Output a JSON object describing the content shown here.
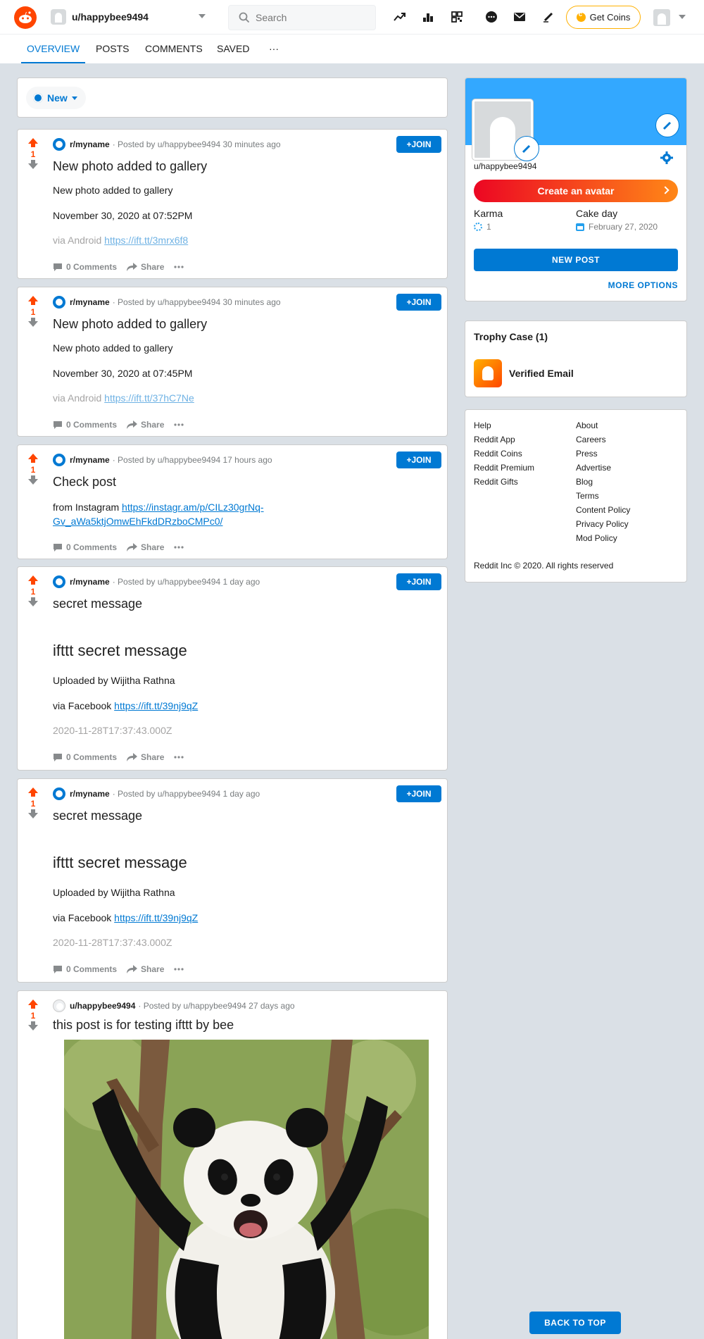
{
  "header": {
    "username": "u/happybee9494",
    "search_placeholder": "Search",
    "coins_label": "Get Coins"
  },
  "tabs": [
    "OVERVIEW",
    "POSTS",
    "COMMENTS",
    "SAVED",
    "···"
  ],
  "sort": {
    "label": "New"
  },
  "posts": [
    {
      "subreddit": "r/myname",
      "posted_by": "· Posted by u/happybee9494 30 minutes ago",
      "votes": "1",
      "join": "+JOIN",
      "title": "New photo added to gallery",
      "line1": "New photo added to gallery",
      "line2": "November 30, 2020 at 07:52PM",
      "via": "via Android ",
      "link": "https://ift.tt/3mrx6f8",
      "comments": "0 Comments",
      "share": "Share"
    },
    {
      "subreddit": "r/myname",
      "posted_by": "· Posted by u/happybee9494 30 minutes ago",
      "votes": "1",
      "join": "+JOIN",
      "title": "New photo added to gallery",
      "line1": "New photo added to gallery",
      "line2": "November 30, 2020 at 07:45PM",
      "via": "via Android ",
      "link": "https://ift.tt/37hC7Ne",
      "comments": "0 Comments",
      "share": "Share"
    },
    {
      "subreddit": "r/myname",
      "posted_by": "· Posted by u/happybee9494 17 hours ago",
      "votes": "1",
      "join": "+JOIN",
      "title": "Check post",
      "from": "from Instagram ",
      "link_a": "https://instagr.am/p/CILz30grNq-",
      "link_b": "Gv_aWa5ktjOmwEhFkdDRzboCMPc0/",
      "comments": "0 Comments",
      "share": "Share"
    },
    {
      "subreddit": "r/myname",
      "posted_by": "· Posted by u/happybee9494 1 day ago",
      "votes": "1",
      "join": "+JOIN",
      "title": "secret message",
      "heading": "ifttt secret message",
      "uploaded": "Uploaded by Wijitha Rathna",
      "via": "via Facebook ",
      "link": "https://ift.tt/39nj9qZ",
      "timestamp": "2020-11-28T17:37:43.000Z",
      "comments": "0 Comments",
      "share": "Share"
    },
    {
      "subreddit": "r/myname",
      "posted_by": "· Posted by u/happybee9494 1 day ago",
      "votes": "1",
      "join": "+JOIN",
      "title": "secret message",
      "heading": "ifttt secret message",
      "uploaded": "Uploaded by Wijitha Rathna",
      "via": "via Facebook ",
      "link": "https://ift.tt/39nj9qZ",
      "timestamp": "2020-11-28T17:37:43.000Z",
      "comments": "0 Comments",
      "share": "Share"
    },
    {
      "subreddit": "u/happybee9494",
      "posted_by": "· Posted by u/happybee9494 27 days ago",
      "votes": "1",
      "title": "this post is for testing ifttt by bee"
    }
  ],
  "profile": {
    "username": "u/happybee9494",
    "create_avatar": "Create an avatar",
    "karma_label": "Karma",
    "karma_value": "1",
    "cakeday_label": "Cake day",
    "cakeday_value": "February 27, 2020",
    "new_post": "NEW POST",
    "more_options": "MORE OPTIONS"
  },
  "trophy": {
    "title": "Trophy Case (1)",
    "item": "Verified Email"
  },
  "footer": {
    "col1": [
      "Help",
      "Reddit App",
      "Reddit Coins",
      "Reddit Premium",
      "Reddit Gifts"
    ],
    "col2": [
      "About",
      "Careers",
      "Press",
      "Advertise",
      "Blog",
      "Terms",
      "Content Policy",
      "Privacy Policy",
      "Mod Policy"
    ],
    "copyright": "Reddit Inc © 2020. All rights reserved"
  },
  "back_to_top": "BACK TO TOP"
}
